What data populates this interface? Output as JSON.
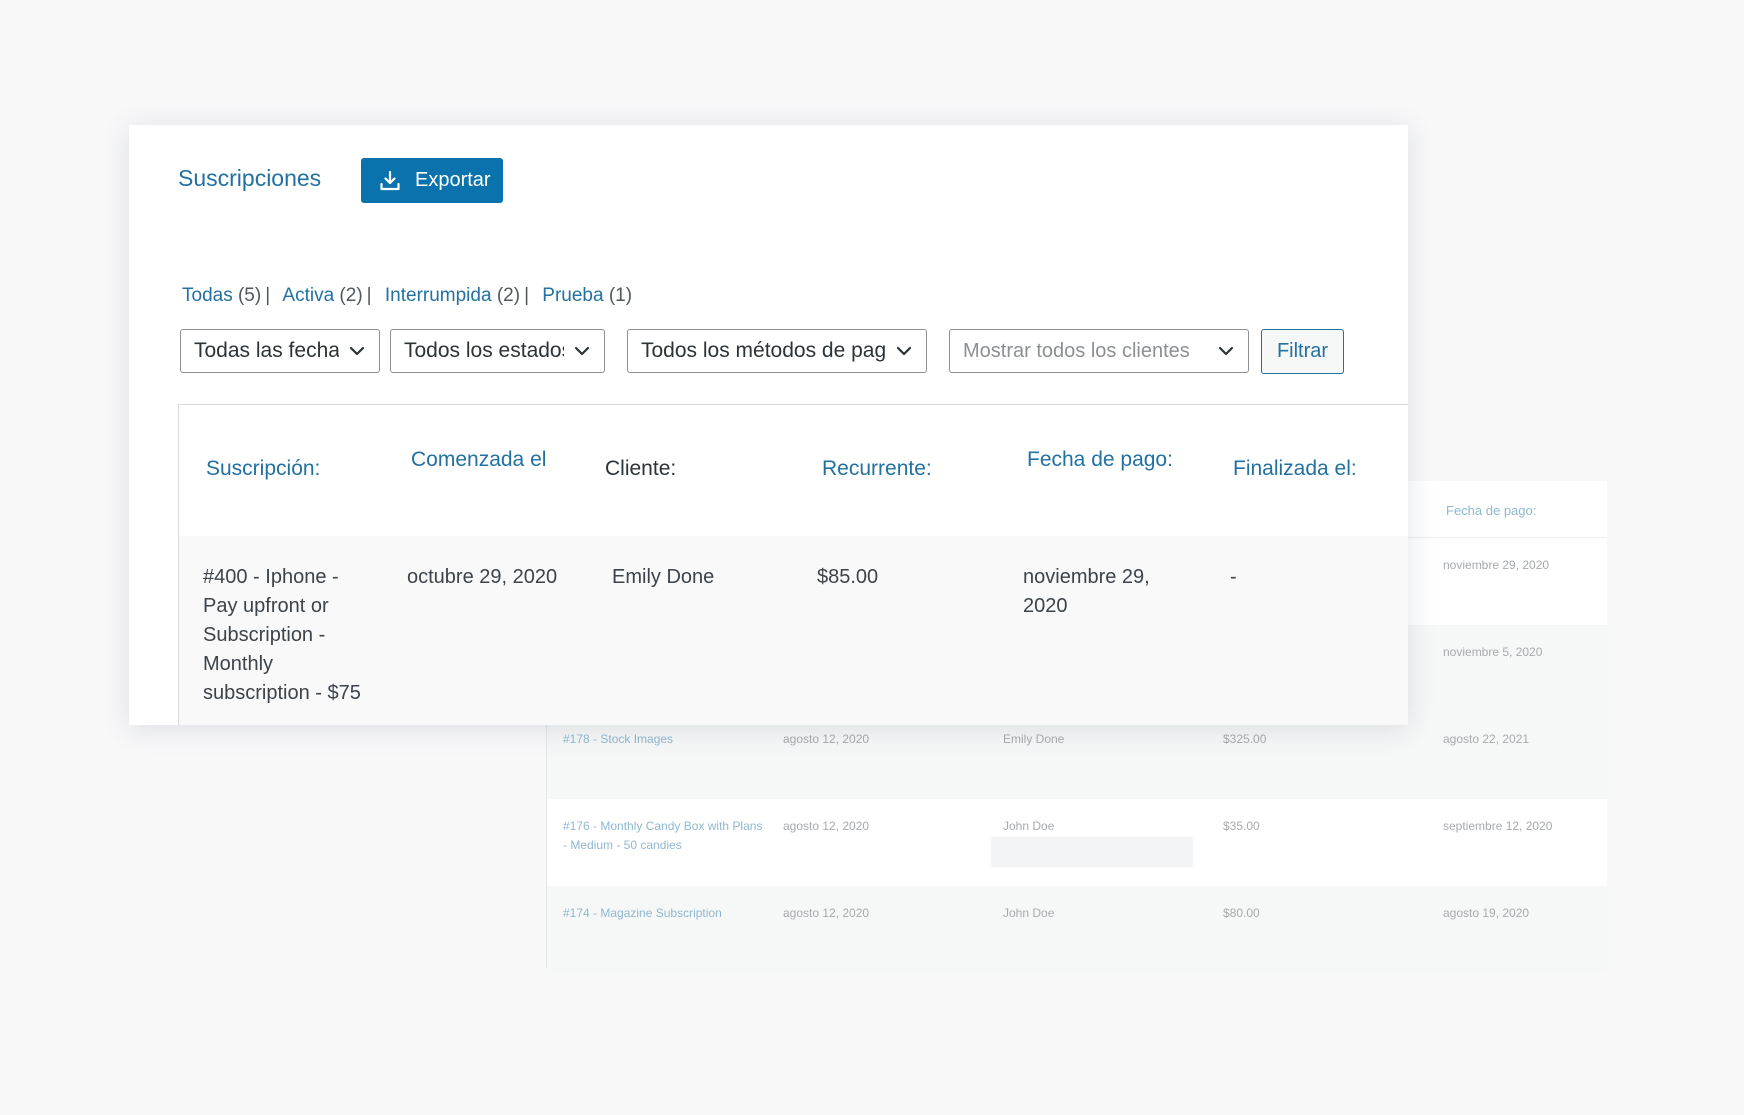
{
  "background_table": {
    "header_label": "Fecha de pago:",
    "rows": [
      {
        "subscription": "",
        "started": "",
        "client": "",
        "amount": "",
        "paydate": "noviembre 29, 2020"
      },
      {
        "subscription": "",
        "started": "",
        "client": "",
        "amount": "",
        "paydate": "noviembre 5, 2020"
      },
      {
        "subscription": "#178 - Stock Images",
        "started": "agosto 12, 2020",
        "client": "Emily Done",
        "amount": "$325.00",
        "paydate": "agosto 22, 2021"
      },
      {
        "subscription": "#176 - Monthly Candy Box with Plans - Medium - 50 candies",
        "started": "agosto 12, 2020",
        "client": "John Doe",
        "amount": "$35.00",
        "paydate": "septiembre 12, 2020"
      },
      {
        "subscription": "#174 - Magazine Subscription",
        "started": "agosto 12, 2020",
        "client": "John Doe",
        "amount": "$80.00",
        "paydate": "agosto 19, 2020"
      }
    ]
  },
  "header": {
    "title": "Suscripciones",
    "export_label": "Exportar"
  },
  "status_links": [
    {
      "label": "Todas",
      "count": "(5)"
    },
    {
      "label": "Activa",
      "count": "(2)"
    },
    {
      "label": "Interrumpida",
      "count": "(2)"
    },
    {
      "label": "Prueba",
      "count": "(1)"
    }
  ],
  "filters": {
    "dates": "Todas las fechas",
    "states": "Todos los estados",
    "methods": "Todos los métodos de pago",
    "clients_placeholder": "Mostrar todos los clientes",
    "filter_button": "Filtrar"
  },
  "table": {
    "columns": {
      "subscription": "Suscripción:",
      "started": "Comenzada el",
      "client": "Cliente:",
      "recurring": "Recurrente:",
      "paydate": "Fecha de pago:",
      "ended": "Finalizada el:"
    },
    "rows": [
      {
        "subscription": "#400 - Iphone - Pay upfront or Subscription - Monthly subscription - $75",
        "started": "octubre 29, 2020",
        "client": "Emily Done",
        "recurring": "$85.00",
        "paydate": "noviembre 29, 2020",
        "ended": "-"
      }
    ]
  },
  "colors": {
    "accent": "#2271a1",
    "button_primary": "#0a72ad"
  }
}
